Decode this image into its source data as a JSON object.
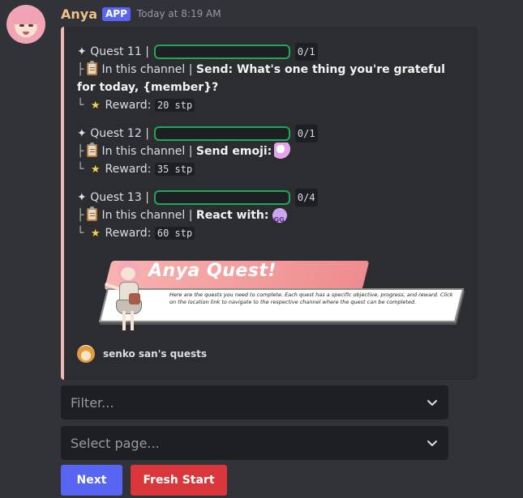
{
  "message": {
    "username": "Anya",
    "badge": "APP",
    "timestamp": "Today at 8:19 AM"
  },
  "embed": {
    "accent_color": "#f0b8b0",
    "quests": [
      {
        "title": "Quest 11",
        "progress": "0/1",
        "progress_fraction": 0,
        "location": "In this channel",
        "objective": "Send: What's one thing you're grateful for today, {member}?",
        "objective_emoji": null,
        "reward_label": "Reward:",
        "reward": "20 stp"
      },
      {
        "title": "Quest 12",
        "progress": "0/1",
        "progress_fraction": 0,
        "location": "In this channel",
        "objective": "Send emoji:",
        "objective_emoji": "unicorn-emoji",
        "reward_label": "Reward:",
        "reward": "35 stp"
      },
      {
        "title": "Quest 13",
        "progress": "0/4",
        "progress_fraction": 0,
        "location": "In this channel",
        "objective": "React with:",
        "objective_emoji": "gg-emoji",
        "reward_label": "Reward:",
        "reward": "60 stp"
      }
    ],
    "banner": {
      "title": "Anya Quest!",
      "description": "Here are the quests you need to complete. Each quest has a specific objective, progress, and reward. Click on the location link to navigate to the respective channel where the quest can be completed."
    },
    "footer": "senko san's quests"
  },
  "components": {
    "filter_placeholder": "Filter...",
    "page_placeholder": "Select page...",
    "next_label": "Next",
    "fresh_start_label": "Fresh Start"
  },
  "colors": {
    "primary_button": "#5865f2",
    "danger_button": "#da373c",
    "progress_border": "#23a55a"
  }
}
